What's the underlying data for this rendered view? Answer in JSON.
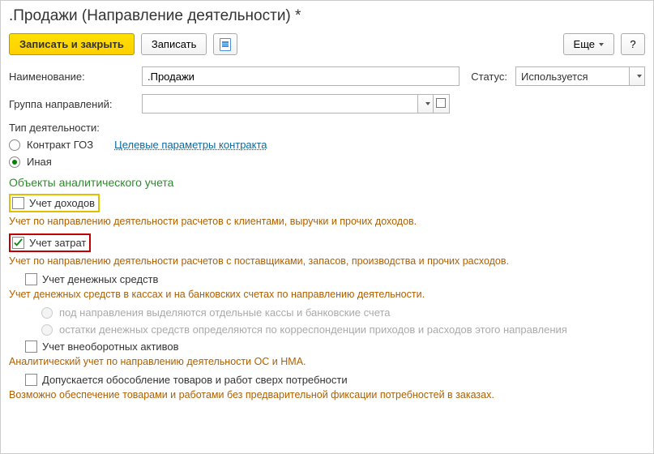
{
  "title": ".Продажи (Направление деятельности) *",
  "toolbar": {
    "save_close": "Записать и закрыть",
    "save": "Записать",
    "more": "Еще",
    "help": "?"
  },
  "fields": {
    "name_label": "Наименование:",
    "name_value": ".Продажи",
    "status_label": "Статус:",
    "status_value": "Используется",
    "group_label": "Группа направлений:",
    "group_value": "",
    "type_label": "Тип деятельности:",
    "type_options": {
      "goz": "Контракт ГОЗ",
      "goz_link": "Целевые параметры контракта",
      "other": "Иная"
    }
  },
  "section_title": "Объекты аналитического учета",
  "checks": {
    "income": {
      "label": "Учет доходов",
      "desc": "Учет по направлению деятельности расчетов с клиентами, выручки и прочих доходов."
    },
    "expense": {
      "label": "Учет затрат",
      "desc": "Учет по направлению деятельности расчетов с поставщиками, запасов, производства и прочих расходов."
    },
    "cash": {
      "label": "Учет денежных средств",
      "desc": "Учет денежных средств в кассах и на банковских счетах по направлению деятельности.",
      "sub1": "под направления выделяются отдельные кассы и банковские счета",
      "sub2": "остатки денежных средств определяются по корреспонденции приходов и расходов этого направления"
    },
    "fixed": {
      "label": "Учет внеоборотных активов",
      "desc": "Аналитический учет по направлению деятельности ОС и НМА."
    },
    "over": {
      "label": "Допускается обособление товаров и работ сверх потребности",
      "desc": "Возможно обеспечение товарами и работами без предварительной фиксации потребностей в заказах."
    }
  }
}
